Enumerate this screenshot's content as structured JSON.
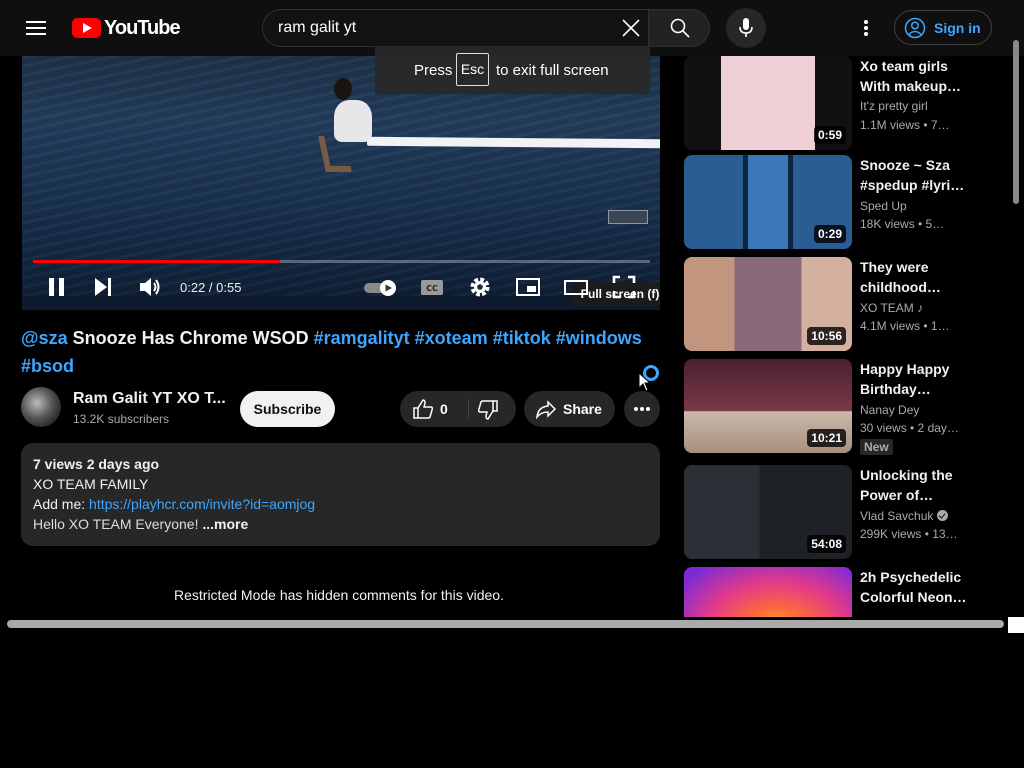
{
  "header": {
    "logo_text": "YouTube",
    "search_value": "ram galit yt",
    "signin_label": "Sign in"
  },
  "toast": {
    "pre": "Press",
    "key": "Esc",
    "post": "to exit full screen"
  },
  "player": {
    "tooltip": "Full screen (f)",
    "time": "0:22 / 0:55",
    "progress_fraction": 0.4
  },
  "video": {
    "title_tag1": "@sza",
    "title_main": " Snooze Has Chrome WSOD ",
    "title_tags": "#ramgalityt #xoteam #tiktok #windows",
    "title_tag_last": "#bsod"
  },
  "channel": {
    "name": "Ram Galit YT XO T...",
    "subs": "13.2K subscribers",
    "subscribe_label": "Subscribe",
    "like_count": "0",
    "share_label": "Share"
  },
  "description": {
    "stats": "7 views  2 days ago",
    "line1": "XO TEAM FAMILY",
    "line2_label": "Add me: ",
    "line2_link": "https://playhcr.com/invite?id=aomjog",
    "line3": "Hello XO TEAM Everyone! ",
    "more": "...more"
  },
  "restricted": "Restricted Mode has hidden comments for this video.",
  "sidebar": [
    {
      "title": "Xo team girls With makeup…",
      "channel": "It'z pretty girl",
      "meta": "1.1M views  • 7…",
      "duration": "0:59",
      "color": "#e9c8cf"
    },
    {
      "title": "Snooze ~ Sza #spedup #lyri…",
      "channel": "Sped Up",
      "meta": "18K views  • 5…",
      "duration": "0:29",
      "color": "#2a5d93"
    },
    {
      "title": "They were childhood…",
      "channel": "XO TEAM",
      "meta": "4.1M views  • 1…",
      "duration": "10:56",
      "color": "#b88c78"
    },
    {
      "title": "Happy Happy Birthday…",
      "channel": "Nanay Dey",
      "meta": "30 views  • 2 day…",
      "duration": "10:21",
      "badge": "New",
      "color": "#6b3642"
    },
    {
      "title": "Unlocking the Power of…",
      "channel": "Vlad Savchuk",
      "meta": "299K views  • 13…",
      "duration": "54:08",
      "color": "#2b3036"
    },
    {
      "title": "2h Psychedelic Colorful Neon…",
      "channel": "",
      "meta": "",
      "duration": "",
      "color": "#d6338a"
    }
  ]
}
